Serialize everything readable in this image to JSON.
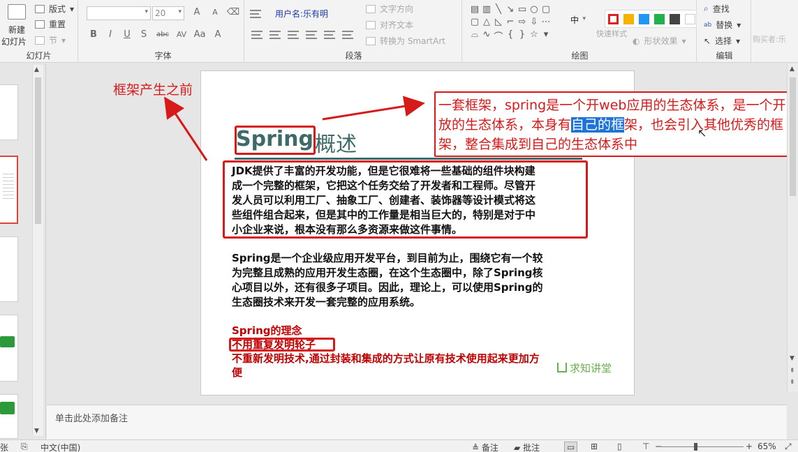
{
  "ribbon": {
    "slides_group": {
      "label": "幻灯片",
      "new_slide": "新建",
      "new_slide_sub": "幻灯片",
      "layout": "版式",
      "reset": "重置",
      "section": "节"
    },
    "font_group": {
      "label": "字体",
      "font_name": "",
      "font_size": "20",
      "bold": "B",
      "italic": "I",
      "underline": "U",
      "shadow": "S",
      "strike": "abc",
      "spacing": "AV",
      "case": "Aa",
      "color": "A",
      "grow": "A",
      "shrink": "A"
    },
    "paragraph_group": {
      "label": "段落",
      "text_direction": "文字方向",
      "align_text": "对齐文本",
      "smartart": "转换为 SmartArt",
      "tooltip_user": "用户名:乐有明"
    },
    "drawing_group": {
      "label": "绘图",
      "shape_effects": "形状效果",
      "quick_style": "快速样式",
      "dropdown_value": "中",
      "swatches": [
        "#ffffff",
        "#f5b400",
        "#2196f3",
        "#22b14c",
        "#444444",
        "#ffffff"
      ],
      "swatch_selected": "#e01f1f"
    },
    "editing_group": {
      "label": "编辑",
      "find": "查找",
      "replace": "替换",
      "select": "选择"
    },
    "right_edge_text": "购买者:乐"
  },
  "slide": {
    "title_bold": "Spring",
    "title_rest": "概述",
    "paragraph1": [
      "JDK提供了丰富的开发功能，但是它很难将一些基础的组件块构建",
      "成一个完整的框架，它把这个任务交给了开发者和工程师。尽管开",
      "发人员可以利用工厂、抽象工厂、创建者、装饰器等设计模式将这",
      "些组件组合起来，但是其中的工作量是相当巨大的，特别是对于中",
      "小企业来说，根本没有那么多资源来做这件事情。"
    ],
    "paragraph2": [
      "Spring是一个企业级应用开发平台，到目前为止，围绕它有一个较",
      "为完整且成熟的应用开发生态圈，在这个生态圈中，除了Spring核",
      "心项目以外，还有很多子项目。因此，理论上，可以使用Spring的",
      "生态圈技术来开发一套完整的应用系统。"
    ],
    "concept_title": "Spring的理念",
    "concept_line1": "不用重复发明轮子",
    "concept_line2": "不重新发明技术,通过封装和集成的方式让原有技术使用起来更加方",
    "concept_line3": "便",
    "watermark": "求知讲堂"
  },
  "annotations": {
    "left": "框架产生之前",
    "right_before": "一套框架，spring是一个开web应用的生态体系，是一个开放的生态体系，本身有",
    "right_highlight": "自己的框",
    "right_after": "架，也会引入其他优秀的框架，整合集成到自己的生态体系中"
  },
  "notes": {
    "placeholder": "单击此处添加备注"
  },
  "status": {
    "slide_label": "张",
    "language": "中文(中国)",
    "notes_btn": "备注",
    "comments_btn": "批注",
    "zoom": "65%",
    "zoom_level": 0.65
  },
  "colors": {
    "accent_red": "#d61a1a",
    "title_teal": "#3f6a6a",
    "highlight_blue": "#1e73d8"
  }
}
